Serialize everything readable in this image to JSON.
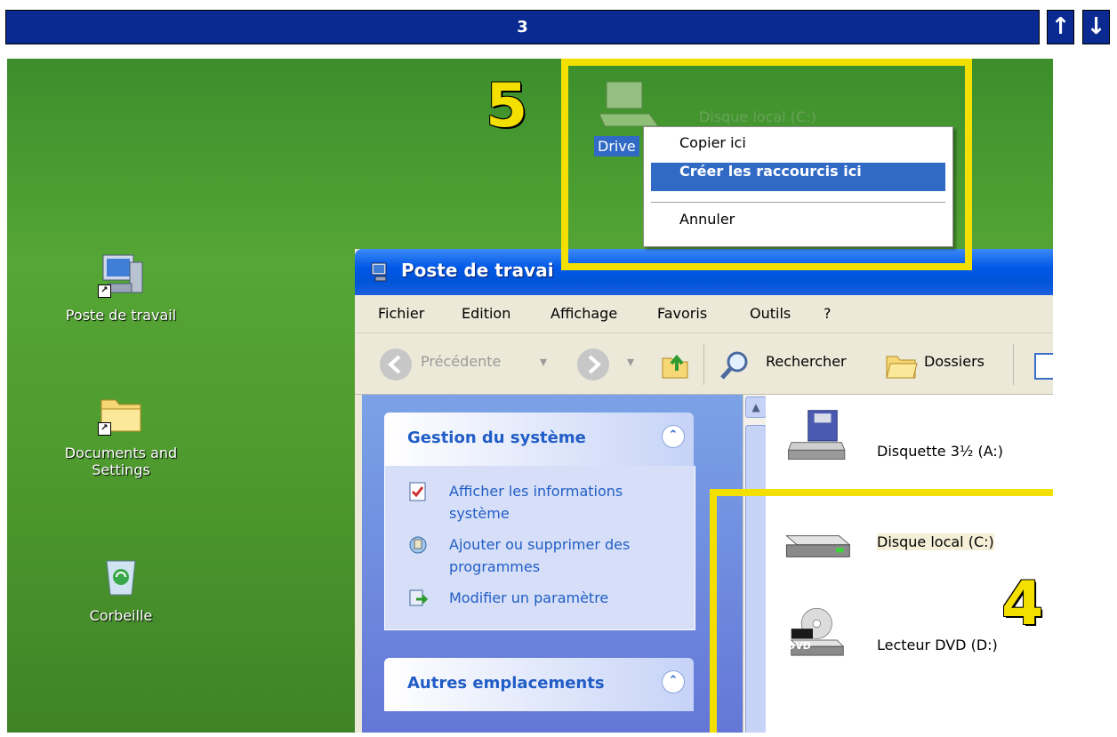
{
  "step_bar": {
    "number": "3",
    "up_arrow": "↑",
    "down_arrow": "↓"
  },
  "annotations": {
    "top_number": "5",
    "bottom_number": "4"
  },
  "desktop": {
    "icons": [
      {
        "label": "Poste de travail",
        "icon": "my-computer-icon"
      },
      {
        "label": "Documents and Settings",
        "icon": "folder-icon"
      },
      {
        "label": "Corbeille",
        "icon": "recycle-bin-icon"
      }
    ],
    "dragged_item_label": "Drive",
    "ghost_label": "Disque local (C:)"
  },
  "context_menu": {
    "items": [
      "Copier ici",
      "Créer les raccourcis ici",
      "Annuler"
    ],
    "selected_index": 1
  },
  "window": {
    "title": "Poste de travai",
    "menu": [
      "Fichier",
      "Edition",
      "Affichage",
      "Favoris",
      "Outils",
      "?"
    ],
    "toolbar": {
      "back": "Précédente",
      "search": "Rechercher",
      "folders": "Dossiers"
    },
    "panels": [
      {
        "title": "Gestion du système",
        "tasks": [
          "Afficher les informations système",
          "Ajouter ou supprimer des programmes",
          "Modifier un paramètre"
        ]
      },
      {
        "title": "Autres emplacements"
      }
    ],
    "drives": [
      "Disquette 3½ (A:)",
      "Disque local (C:)",
      "Lecteur DVD (D:)"
    ],
    "dvd_badge": "DVD"
  },
  "colors": {
    "highlight": "#f4e000",
    "step_bar": "#0a2a92",
    "menu_selection": "#316ac5"
  }
}
